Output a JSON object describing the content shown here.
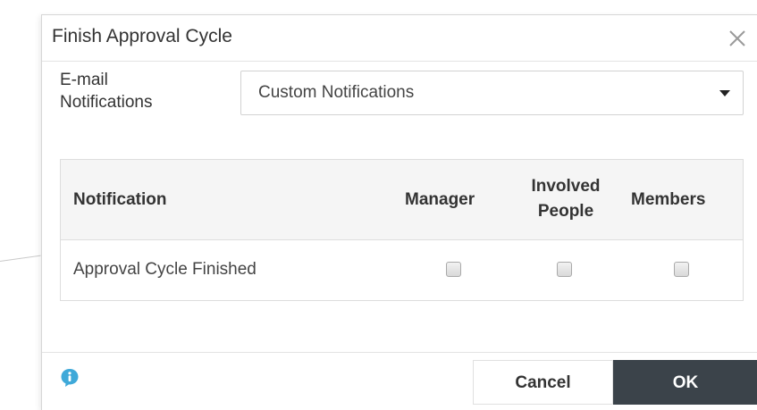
{
  "dialog": {
    "title": "Finish Approval Cycle",
    "close_icon": "close-icon"
  },
  "email_notifications": {
    "label_line1": "E-mail",
    "label_line2": "Notifications",
    "selected": "Custom Notifications"
  },
  "table": {
    "headers": {
      "notification": "Notification",
      "manager": "Manager",
      "involved_line1": "Involved",
      "involved_line2": "People",
      "members": "Members"
    },
    "rows": [
      {
        "label": "Approval Cycle Finished",
        "manager": false,
        "involved_people": false,
        "members": false
      }
    ]
  },
  "footer": {
    "info_icon": "info-icon",
    "info_color": "#3fa9d9",
    "cancel_label": "Cancel",
    "ok_label": "OK",
    "ok_color": "#3b434a"
  }
}
